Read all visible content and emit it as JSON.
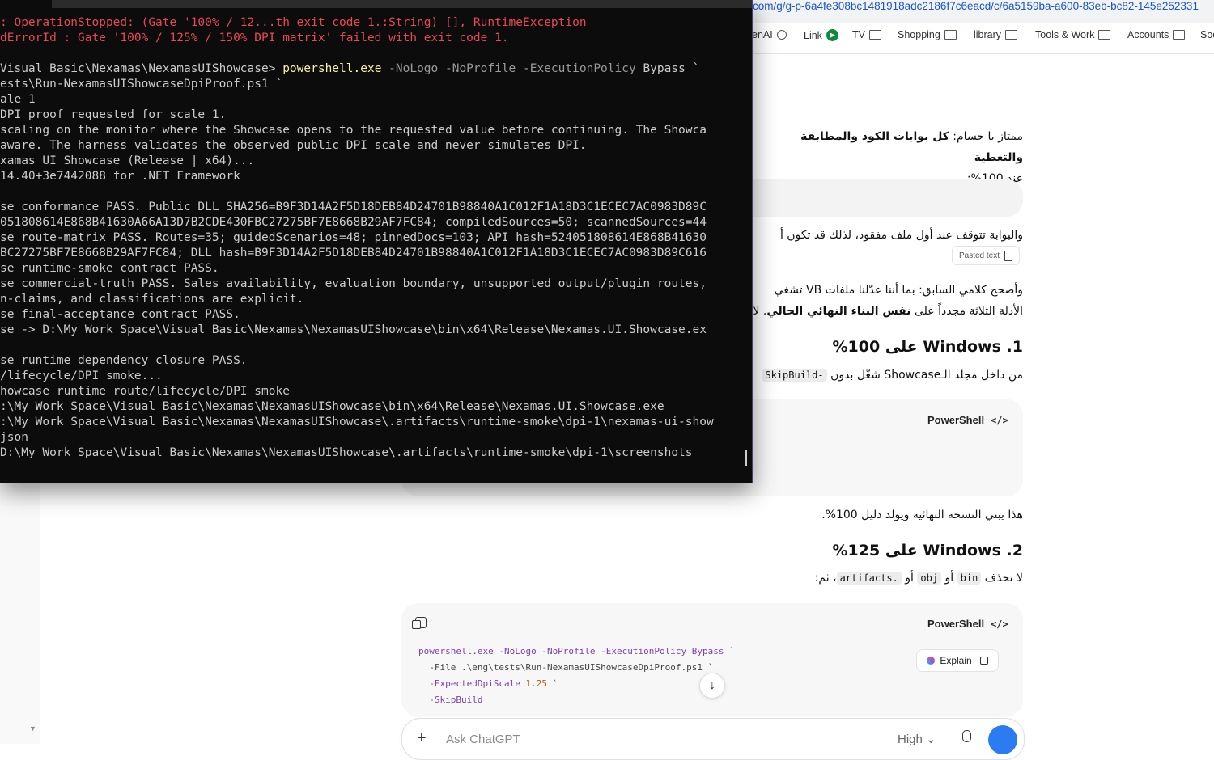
{
  "browser": {
    "url": "com/g/g-p-6a4fe308bc1481918adc2186f7c6eacd/c/6a5159ba-a600-83eb-bc82-145e252331",
    "bookmarks": [
      {
        "label": "enAI",
        "icon": "globe-icon"
      },
      {
        "label": "Link",
        "icon": "link-icon"
      },
      {
        "label": "TV",
        "icon": "folder-icon"
      },
      {
        "label": "Shopping",
        "icon": "folder-icon"
      },
      {
        "label": "library",
        "icon": "folder-icon"
      },
      {
        "label": "Tools & Work",
        "icon": "folder-icon"
      },
      {
        "label": "Accounts",
        "icon": "folder-icon"
      },
      {
        "label": "Soc",
        "icon": "folder-icon"
      }
    ]
  },
  "chat": {
    "p1_a": "ممتاز يا حسام: ",
    "p1_b": "كل بوابات الكود والمطابقة والتغطية",
    "p1_c": "عند 100%:",
    "p2": "والبوابة تتوقف عند أول ملف مفقود، لذلك قد تكون أ",
    "pasted_label": "Pasted text",
    "p3_a": "وأصحح كلامي السابق: بما أننا عدّلنا ملفات VB تشغي",
    "p3_b": "الأدلة الثلاثة مجدداً على ",
    "p3_c": "نفس البناء النهائي الحالي",
    "p3_d": ". لا",
    "h1": "1. Windows على 100%",
    "p4_a": "من داخل مجلد الـShowcase شغّل بدون ",
    "p4_code": "SkipBuild-",
    "codebox1_lang": "PowerShell",
    "p5": "هذا يبني النسخة النهائية ويولد دليل 100%.",
    "h2": "2. Windows على 125%",
    "p6_a": "لا تحذف ",
    "p6_bin": "bin",
    "p6_or1": " أو ",
    "p6_obj": "obj",
    "p6_or2": " أو ",
    "p6_artifacts": "artifacts.",
    "p6_end": "، ثم:",
    "codebox2_lang": "PowerShell",
    "explain_label": "Explain",
    "code2": {
      "l1": "powershell.exe -NoLogo -NoProfile -ExecutionPolicy Bypass `",
      "l2a": "  -File ",
      "l2b": ".\\eng\\tests\\Run-NexamasUIShowcaseDpiProof.ps1",
      "l2c": " `",
      "l3a": "  -ExpectedDpiScale ",
      "l3b": "1.25",
      "l3c": " `",
      "l4": "  -SkipBuild"
    },
    "composer_placeholder": "Ask ChatGPT",
    "model_label": "High"
  },
  "terminal": {
    "lines": [
      ": OperationStopped: (Gate '100% / 12...th exit code 1.:String) [], RuntimeException",
      "dErrorId : Gate '100% / 125% / 150% DPI matrix' failed with exit code 1.",
      "",
      "Visual Basic\\Nexamas\\NexamasUIShowcase> ",
      "ests\\Run-NexamasUIShowcaseDpiProof.ps1 `",
      "ale 1",
      "DPI proof requested for scale 1.",
      "scaling on the monitor where the Showcase opens to the requested value before continuing. The Showca",
      "aware. The harness validates the observed public DPI scale and never simulates DPI.",
      "xamas UI Showcase (Release | x64)...",
      "14.40+3e7442088 for .NET Framework",
      "",
      "se conformance PASS. Public DLL SHA256=B9F3D14A2F5D18DEB84D24701B98840A1C012F1A18D3C1ECEC7AC0983D89C",
      "051808614E868B41630A66A13D7B2CDE430FBC27275BF7E8668B29AF7FC84; compiledSources=50; scannedSources=44",
      "se route-matrix PASS. Routes=35; guidedScenarios=48; pinnedDocs=103; API hash=524051808614E868B41630",
      "BC27275BF7E8668B29AF7FC84; DLL hash=B9F3D14A2F5D18DEB84D24701B98840A1C012F1A18D3C1ECEC7AC0983D89C616",
      "se runtime-smoke contract PASS.",
      "se commercial-truth PASS. Sales availability, evaluation boundary, unsupported output/plugin routes,",
      "n-claims, and classifications are explicit.",
      "se final-acceptance contract PASS.",
      "se -> D:\\My Work Space\\Visual Basic\\Nexamas\\NexamasUIShowcase\\bin\\x64\\Release\\Nexamas.UI.Showcase.ex",
      "",
      "se runtime dependency closure PASS.",
      "/lifecycle/DPI smoke...",
      "howcase runtime route/lifecycle/DPI smoke",
      ":\\My Work Space\\Visual Basic\\Nexamas\\NexamasUIShowcase\\bin\\x64\\Release\\Nexamas.UI.Showcase.exe",
      ":\\My Work Space\\Visual Basic\\Nexamas\\NexamasUIShowcase\\.artifacts\\runtime-smoke\\dpi-1\\nexamas-ui-show",
      "json",
      "D:\\My Work Space\\Visual Basic\\Nexamas\\NexamasUIShowcase\\.artifacts\\runtime-smoke\\dpi-1\\screenshots"
    ],
    "cmd_exe": "powershell.exe",
    "cmd_args": " -NoLogo -NoProfile -ExecutionPolicy ",
    "cmd_bypass": "Bypass `"
  }
}
